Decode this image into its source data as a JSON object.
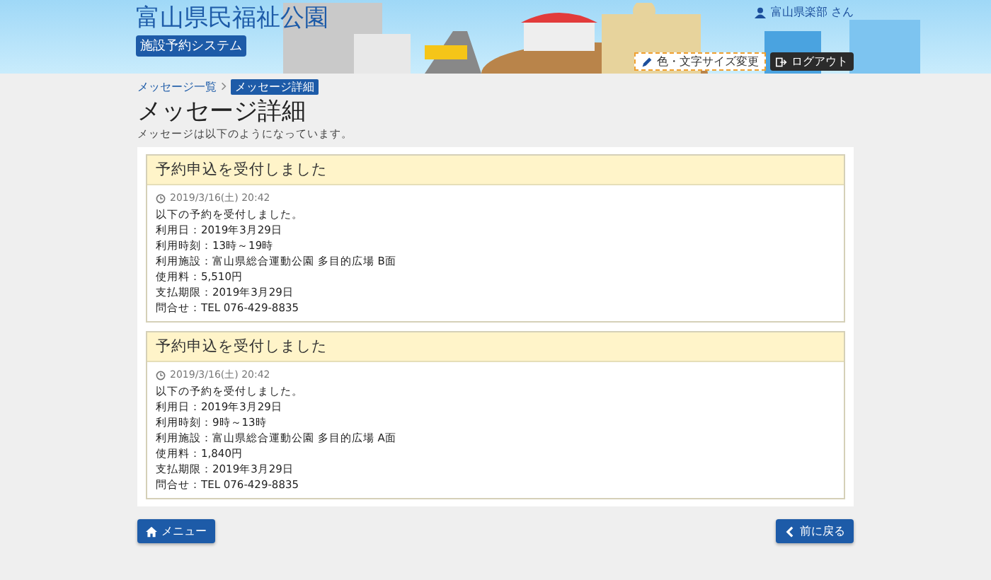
{
  "header": {
    "site_title": "富山県民福祉公園",
    "system_badge": "施設予約システム",
    "user_name": "富山県楽部 さん",
    "color_button": "色・文字サイズ変更",
    "logout_button": "ログアウト"
  },
  "breadcrumb": [
    {
      "label": "メッセージ一覧",
      "selected": false
    },
    {
      "label": "メッセージ詳細",
      "selected": true
    }
  ],
  "page_title": "メッセージ詳細",
  "page_subtitle": "メッセージは以下のようになっています。",
  "messages": [
    {
      "title": "予約申込を受付しました",
      "datetime": "2019/3/16(土) 20:42",
      "lines": [
        "以下の予約を受付しました。",
        "利用日：2019年3月29日",
        "利用時刻：13時～19時",
        "利用施設：富山県総合運動公園 多目的広場 B面",
        "使用料：5,510円",
        "支払期限：2019年3月29日",
        "問合せ：TEL 076-429-8835"
      ]
    },
    {
      "title": "予約申込を受付しました",
      "datetime": "2019/3/16(土) 20:42",
      "lines": [
        "以下の予約を受付しました。",
        "利用日：2019年3月29日",
        "利用時刻：9時～13時",
        "利用施設：富山県総合運動公園 多目的広場 A面",
        "使用料：1,840円",
        "支払期限：2019年3月29日",
        "問合せ：TEL 076-429-8835"
      ]
    }
  ],
  "footer": {
    "menu_button": "メニュー",
    "back_button": "前に戻る"
  }
}
